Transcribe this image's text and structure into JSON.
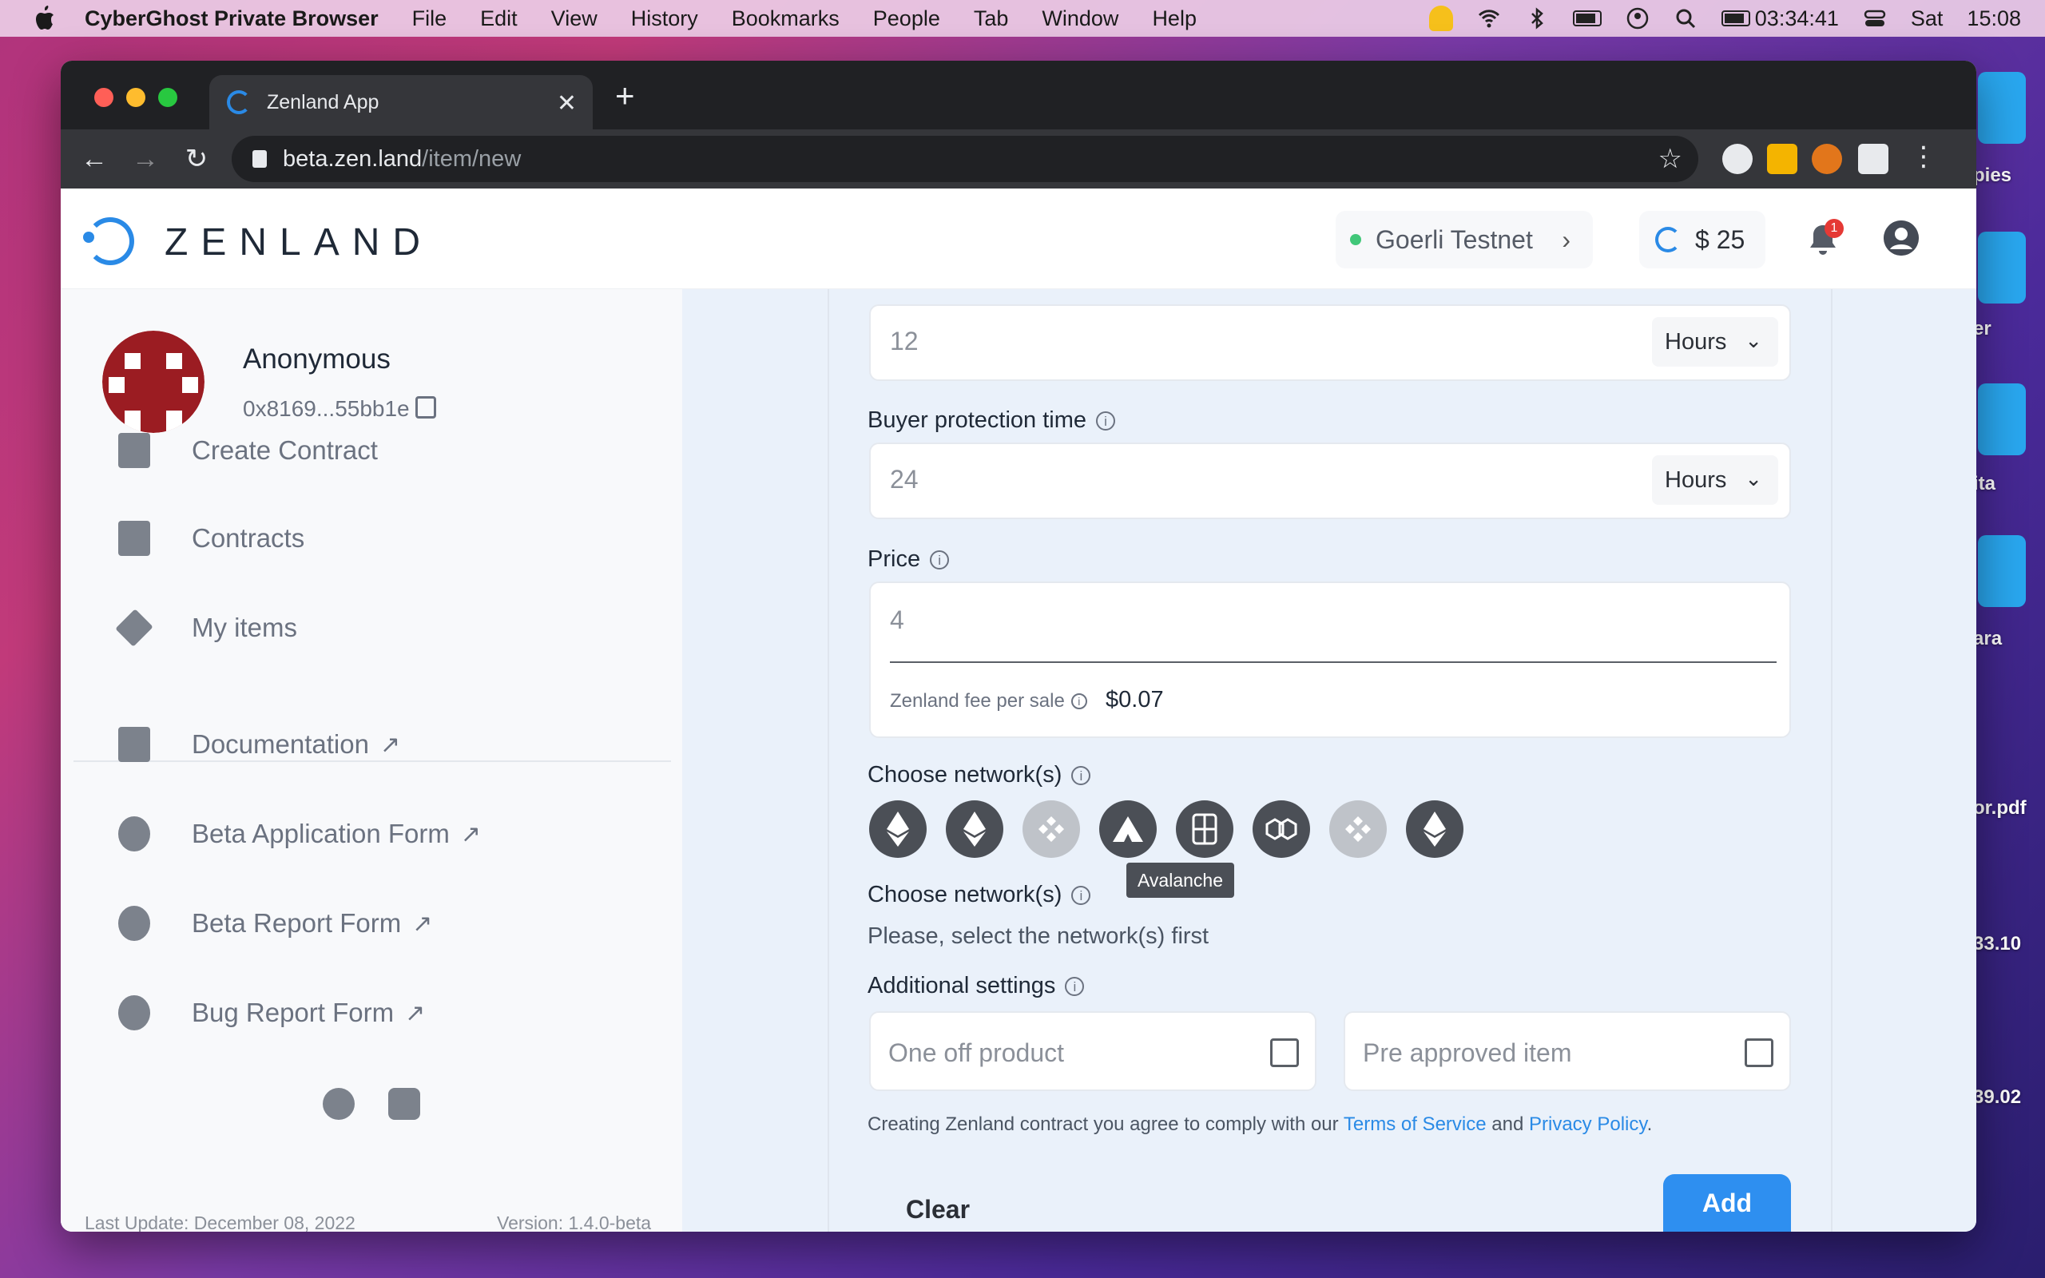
{
  "menubar": {
    "app_name": "CyberGhost Private Browser",
    "items": [
      "File",
      "Edit",
      "View",
      "History",
      "Bookmarks",
      "People",
      "Tab",
      "Window",
      "Help"
    ],
    "timer": "03:34:41",
    "day": "Sat",
    "time": "15:08"
  },
  "desktop": {
    "labels": [
      "pies",
      "er",
      "ita",
      "ara",
      "or.pdf",
      "33.10",
      "39.02"
    ]
  },
  "browser": {
    "tab_title": "Zenland App",
    "url_host": "beta.zen.land",
    "url_path": "/item/new"
  },
  "header": {
    "logo_text": "ZENLAND",
    "network": "Goerli Testnet",
    "balance": "$ 25",
    "notification_count": "1"
  },
  "sidebar": {
    "user_name": "Anonymous",
    "user_address": "0x8169...55bb1e",
    "nav": [
      {
        "label": "Create Contract",
        "icon": "file-plus-icon"
      },
      {
        "label": "Contracts",
        "icon": "file-icon"
      },
      {
        "label": "My items",
        "icon": "layers-icon"
      }
    ],
    "links": [
      {
        "label": "Documentation",
        "icon": "book-icon"
      },
      {
        "label": "Beta Application Form",
        "icon": "bug-icon"
      },
      {
        "label": "Beta Report Form",
        "icon": "bug-icon"
      },
      {
        "label": "Bug Report Form",
        "icon": "bug-icon"
      }
    ],
    "last_update": "Last Update: December 08, 2022",
    "version": "Version: 1.4.0-beta"
  },
  "form": {
    "first_field_value": "12",
    "first_field_unit": "Hours",
    "buyer_protection_label": "Buyer protection time",
    "buyer_protection_value": "24",
    "buyer_protection_unit": "Hours",
    "price_label": "Price",
    "price_value": "4",
    "fee_label": "Zenland fee per sale",
    "fee_value": "$0.07",
    "network_label": "Choose network(s)",
    "network_tooltip": "Avalanche",
    "network_label_2": "Choose network(s)",
    "network_hint": "Please, select the network(s) first",
    "additional_label": "Additional settings",
    "one_off_label": "One off product",
    "pre_approved_label": "Pre approved item",
    "terms_prefix": "Creating Zenland contract you agree to comply with our ",
    "terms_link": "Terms of Service",
    "terms_and": " and ",
    "privacy_link": "Privacy Policy",
    "terms_suffix": ".",
    "clear_button": "Clear",
    "add_button": "Add"
  },
  "colors": {
    "accent": "#2e8ff0",
    "avatar": "#9b1c22",
    "status_online": "#41c779"
  }
}
